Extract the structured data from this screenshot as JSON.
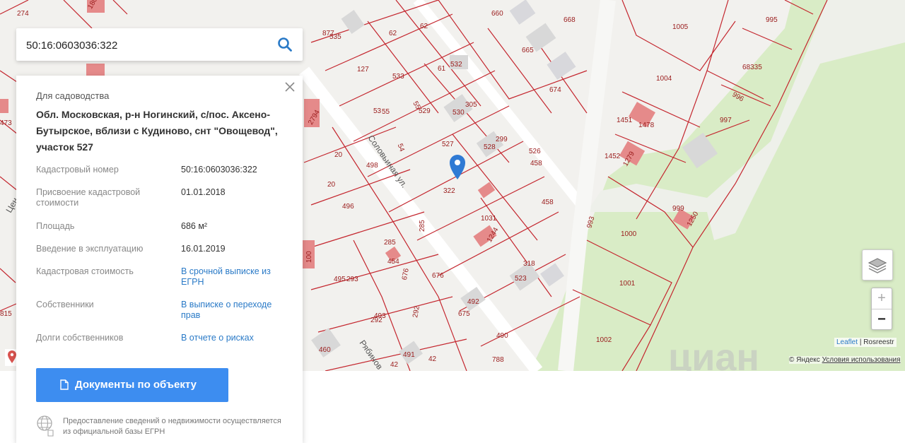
{
  "search": {
    "value": "50:16:0603036:322",
    "icon": "search-icon"
  },
  "card": {
    "type": "Для садоводства",
    "address": "Обл. Московская, р-н Ногинский, с/пос. Аксено-Бутырское, вблизи с Кудиново, снт \"Овощевод\", участок 527",
    "rows": [
      {
        "label": "Кадастровый номер",
        "value": "50:16:0603036:322"
      },
      {
        "label": "Присвоение кадастровой стоимости",
        "value": "01.01.2018"
      },
      {
        "label": "Площадь",
        "value": "686 м²"
      },
      {
        "label": "Введение в эксплуатацию",
        "value": "16.01.2019"
      },
      {
        "label": "Кадастровая стоимость",
        "value": "В срочной выписке из ЕГРН"
      },
      {
        "label": "Собственники",
        "value": "В выписке о переходе прав"
      },
      {
        "label": "Долги собственников",
        "value": "В отчете о рисках"
      }
    ],
    "button": "Документы по объекту",
    "note": "Предоставление сведений о недвижимости осуществляется из официальной базы ЕГРН"
  },
  "map": {
    "streets": [
      "Соловьиная ул.",
      "Рябинов",
      "Цен"
    ],
    "parcels": [
      "274",
      "1805",
      "877",
      "535",
      "62",
      "62",
      "660",
      "668",
      "1005",
      "995",
      "68335",
      "127",
      "533",
      "61",
      "532",
      "665",
      "674",
      "1004",
      "996",
      "997",
      "53",
      "55",
      "55",
      "529",
      "530",
      "305",
      "1451",
      "1478",
      "473",
      "2794",
      "54",
      "527",
      "528",
      "299",
      "526",
      "458",
      "1452",
      "1279",
      "20",
      "498",
      "322",
      "20",
      "496",
      "458",
      "1031",
      "999",
      "1250",
      "285",
      "1244",
      "993",
      "1000",
      "285",
      "454",
      "676",
      "676",
      "318",
      "523",
      "1001",
      "495",
      "293",
      "493",
      "292",
      "292",
      "675",
      "492",
      "1002",
      "460",
      "491",
      "42",
      "42",
      "788",
      "490",
      "815",
      "100"
    ],
    "colors": {
      "background": "#f2f1ee",
      "boundary": "#c4262e",
      "building": "#e58a8a",
      "green": "#d9ecc6",
      "selected_pin": "#2f7ad4"
    }
  },
  "controls": {
    "layers_icon": "layers-icon",
    "zoom_in": "+",
    "zoom_out": "−",
    "attribution_leaflet": "Leaflet",
    "attribution_source": "Rosreestr",
    "copyright": "© Яндекс",
    "terms": "Условия использования",
    "watermark": "циан"
  }
}
